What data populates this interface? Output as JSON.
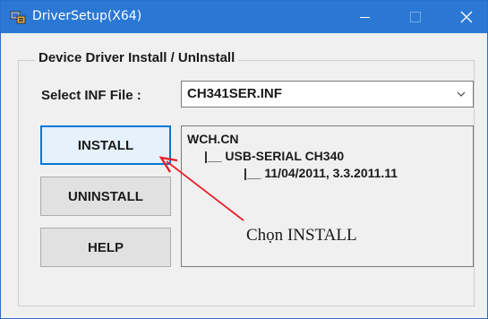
{
  "window": {
    "title": "DriverSetup(X64)"
  },
  "group": {
    "title": "Device Driver Install / UnInstall"
  },
  "inf": {
    "label": "Select INF File :",
    "selected": "CH341SER.INF"
  },
  "buttons": {
    "install": "INSTALL",
    "uninstall": "UNINSTALL",
    "help": "HELP"
  },
  "info": {
    "lines": [
      "WCH.CN",
      "|__ USB-SERIAL CH340",
      "|__ 11/04/2011, 3.3.2011.11"
    ]
  },
  "annotation": {
    "text": "Chọn  INSTALL",
    "color": "#e8202a"
  },
  "icons": {
    "app": "driver-setup-icon",
    "minimize": "minimize-icon",
    "maximize": "maximize-icon",
    "close": "close-icon",
    "dropdown": "chevron-down-icon"
  },
  "colors": {
    "titlebar": "#2b78d4",
    "focus": "#0078d7"
  }
}
